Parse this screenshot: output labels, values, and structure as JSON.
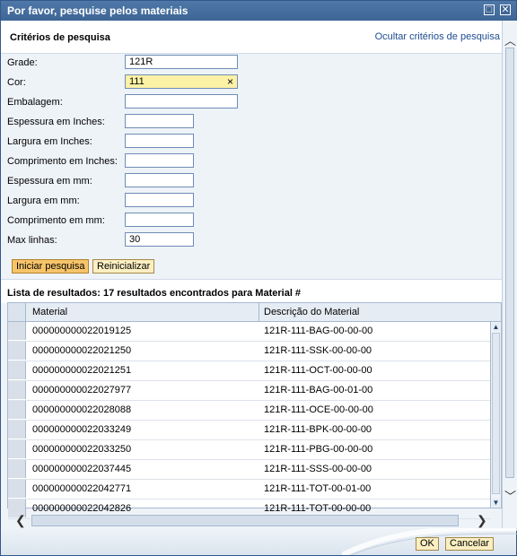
{
  "dialog": {
    "title": "Por favor, pesquise pelos materiais",
    "maximize_icon": "maximize-icon",
    "close_icon": "close-icon"
  },
  "criteria": {
    "heading": "Critérios de pesquisa",
    "hide_link": "Ocultar critérios de pesquisa",
    "fields": [
      {
        "label": "Grade:",
        "value": "121R"
      },
      {
        "label": "Cor:",
        "value": "111"
      },
      {
        "label": "Embalagem:",
        "value": ""
      },
      {
        "label": "Espessura em Inches:",
        "value": ""
      },
      {
        "label": "Largura em Inches:",
        "value": ""
      },
      {
        "label": "Comprimento em Inches:",
        "value": ""
      },
      {
        "label": "Espessura em mm:",
        "value": ""
      },
      {
        "label": "Largura em mm:",
        "value": ""
      },
      {
        "label": "Comprimento em mm:",
        "value": ""
      },
      {
        "label": "Max linhas:",
        "value": "30"
      }
    ],
    "clear_icon": "×",
    "search_button": "Iniciar pesquisa",
    "reset_button": "Reinicializar"
  },
  "results": {
    "heading": "Lista de resultados: 17 resultados encontrados para Material #",
    "columns": [
      "Material",
      "Descrição do Material"
    ],
    "rows": [
      [
        "000000000022019125",
        "121R-111-BAG-00-00-00"
      ],
      [
        "000000000022021250",
        "121R-111-SSK-00-00-00"
      ],
      [
        "000000000022021251",
        "121R-111-OCT-00-00-00"
      ],
      [
        "000000000022027977",
        "121R-111-BAG-00-01-00"
      ],
      [
        "000000000022028088",
        "121R-111-OCE-00-00-00"
      ],
      [
        "000000000022033249",
        "121R-111-BPK-00-00-00"
      ],
      [
        "000000000022033250",
        "121R-111-PBG-00-00-00"
      ],
      [
        "000000000022037445",
        "121R-111-SSS-00-00-00"
      ],
      [
        "000000000022042771",
        "121R-111-TOT-00-01-00"
      ],
      [
        "000000000022042826",
        "121R-111-TOT-00-00-00"
      ]
    ]
  },
  "footer": {
    "ok_button": "OK",
    "cancel_button": "Cancelar"
  },
  "colors": {
    "titlebar": "#3d6595",
    "primary_button": "#f7c46a",
    "secondary_button": "#fbefc2",
    "highlight_field": "#fdf1a5"
  }
}
